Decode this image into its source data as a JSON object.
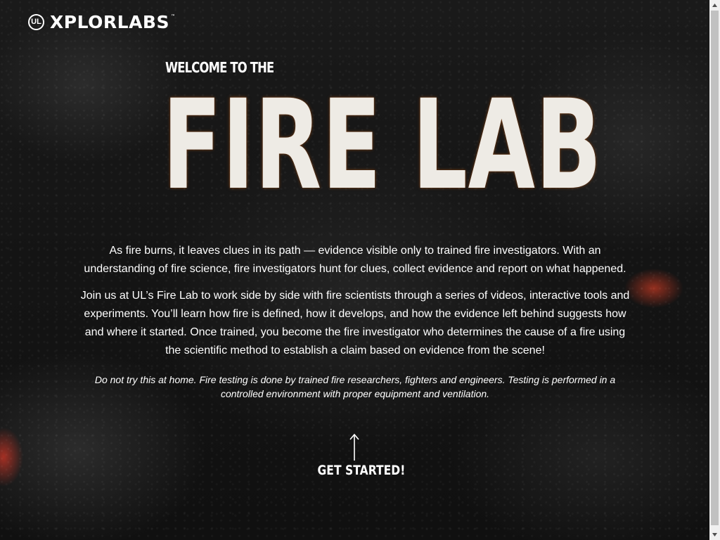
{
  "brand": {
    "ul_mark": "UL",
    "name": "XPLORLABS",
    "trademark": "™"
  },
  "hero": {
    "welcome": "WELCOME TO THE",
    "title": "FIRE LAB"
  },
  "intro": {
    "paragraph_1": "As fire burns, it leaves clues in its path — evidence visible only to trained fire investigators. With an understanding of fire science, fire investigators hunt for clues, collect evidence and report on what happened.",
    "paragraph_2": "Join us at UL’s Fire Lab to work side by side with fire scientists through a series of videos, interactive tools and experiments. You’ll learn how fire is defined, how it develops, and how the evidence left behind suggests how and where it started. Once trained, you become the fire investigator who determines the cause of a fire using the scientific method to establish a claim based on evidence from the scene!",
    "disclaimer": "Do not try this at home. Fire testing is done by trained fire researchers, fighters and engineers. Testing is performed in a controlled environment with proper equipment and ventilation."
  },
  "cta": {
    "label": "GET STARTED!",
    "icon": "arrow-up-icon"
  },
  "colors": {
    "background": "#141414",
    "text": "#ffffff",
    "title": "#eeebe5",
    "ember": "#ff4628"
  }
}
